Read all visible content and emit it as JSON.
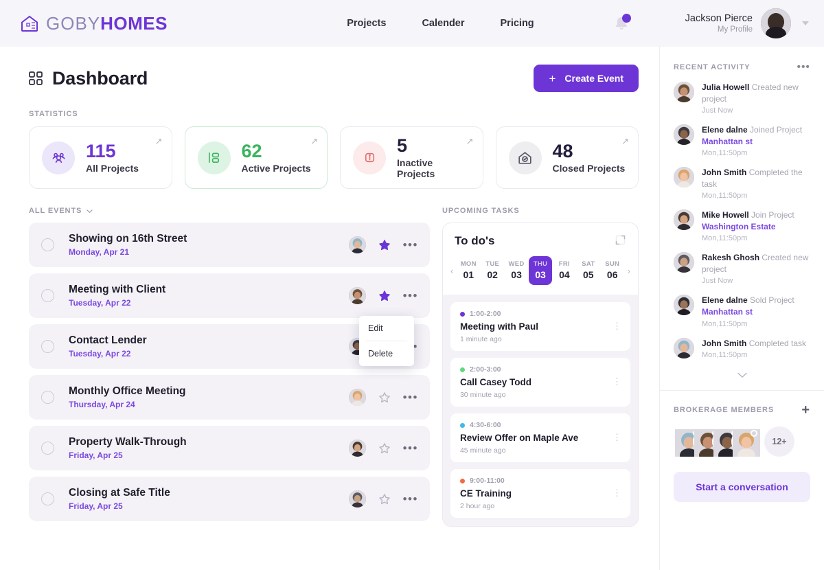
{
  "brand": {
    "part1": "GOBY",
    "part2": "HOMES",
    "logo_icon": "house-logo-icon"
  },
  "nav": {
    "items": [
      {
        "label": "Projects"
      },
      {
        "label": "Calender"
      },
      {
        "label": "Pricing"
      }
    ]
  },
  "header": {
    "bell_icon": "notification-bell-icon",
    "profile_name": "Jackson Pierce",
    "profile_sub": "My Profile"
  },
  "page": {
    "title": "Dashboard",
    "title_icon": "grid-icon",
    "create_button": "Create Event",
    "create_button_icon": "plus-icon",
    "statistics_label": "STATISTICS"
  },
  "stats": [
    {
      "value": "115",
      "label": "All Projects",
      "icon": "users-group-icon",
      "color": "#6d35d6",
      "bg": "#ece6fa",
      "border": "#ebe9f0"
    },
    {
      "value": "62",
      "label": "Active Projects",
      "icon": "list-layout-icon",
      "color": "#3ab45e",
      "bg": "#ddf4e4",
      "border": "#c9ecd4"
    },
    {
      "value": "5",
      "label": "Inactive Projects",
      "icon": "info-square-icon",
      "color": "#231f3d",
      "bg": "#fdeaea",
      "border": "#ebe9f0"
    },
    {
      "value": "48",
      "label": "Closed Projects",
      "icon": "house-check-icon",
      "color": "#231f3d",
      "bg": "#eeedf0",
      "border": "#ebe9f0"
    }
  ],
  "events": {
    "section_label": "ALL EVENTS",
    "items": [
      {
        "title": "Showing on 16th Street",
        "date": "Monday, Apr 21",
        "starred": true
      },
      {
        "title": "Meeting with Client",
        "date": "Tuesday, Apr 22",
        "starred": true
      },
      {
        "title": "Contact Lender",
        "date": "Tuesday, Apr 22",
        "starred": true
      },
      {
        "title": "Monthly Office Meeting",
        "date": "Thursday, Apr 24",
        "starred": false
      },
      {
        "title": "Property Walk-Through",
        "date": "Friday, Apr 25",
        "starred": false
      },
      {
        "title": "Closing at Safe Title",
        "date": "Friday, Apr 25",
        "starred": false
      }
    ]
  },
  "context_menu": {
    "edit": "Edit",
    "delete": "Delete"
  },
  "tasks": {
    "section_label": "UPCOMING TASKS",
    "card_title": "To do's",
    "expand_icon": "expand-icon",
    "days": [
      {
        "dow": "MON",
        "num": "01",
        "active": false
      },
      {
        "dow": "TUE",
        "num": "02",
        "active": false
      },
      {
        "dow": "WED",
        "num": "03",
        "active": false
      },
      {
        "dow": "THU",
        "num": "03",
        "active": true
      },
      {
        "dow": "FRI",
        "num": "04",
        "active": false
      },
      {
        "dow": "SAT",
        "num": "05",
        "active": false
      },
      {
        "dow": "SUN",
        "num": "06",
        "active": false
      }
    ],
    "items": [
      {
        "time": "1:00-2:00",
        "name": "Meeting with Paul",
        "ago": "1 minute ago",
        "dot": "#6d35d6"
      },
      {
        "time": "2:00-3:00",
        "name": "Call Casey Todd",
        "ago": "30 minute ago",
        "dot": "#5fd97f"
      },
      {
        "time": "4:30-6:00",
        "name": "Review Offer on Maple Ave",
        "ago": "45 minute ago",
        "dot": "#43b7e8"
      },
      {
        "time": "9:00-11:00",
        "name": "CE Training",
        "ago": "2 hour ago",
        "dot": "#ef6a43"
      }
    ]
  },
  "activity": {
    "section_label": "RECENT ACTIVITY",
    "items": [
      {
        "user": "Julia Howell",
        "action": "Created new project",
        "link": "",
        "time": "Just Now"
      },
      {
        "user": "Elene dalne",
        "action": "Joined Project",
        "link": "Manhattan st",
        "time": "Mon,11:50pm"
      },
      {
        "user": "John Smith",
        "action": "Completed the task",
        "link": "",
        "time": "Mon,11:50pm"
      },
      {
        "user": "Mike Howell",
        "action": "Join Project",
        "link": "Washington Estate",
        "time": "Mon,11:50pm"
      },
      {
        "user": "Rakesh Ghosh",
        "action": "Created new project",
        "link": "",
        "time": "Just Now"
      },
      {
        "user": "Elene dalne",
        "action": "Sold Project",
        "link": "Manhattan st",
        "time": "Mon,11:50pm"
      },
      {
        "user": "John Smith",
        "action": "Completed task",
        "link": "",
        "time": "Mon,11:50pm"
      }
    ]
  },
  "members": {
    "section_label": "BROKERAGE MEMBERS",
    "add_icon": "plus-icon",
    "overflow": "12+",
    "people": [
      {
        "status": "online"
      },
      {
        "status": "offline"
      },
      {
        "status": "online"
      },
      {
        "status": "offline"
      }
    ],
    "conversation_button": "Start a conversation"
  }
}
